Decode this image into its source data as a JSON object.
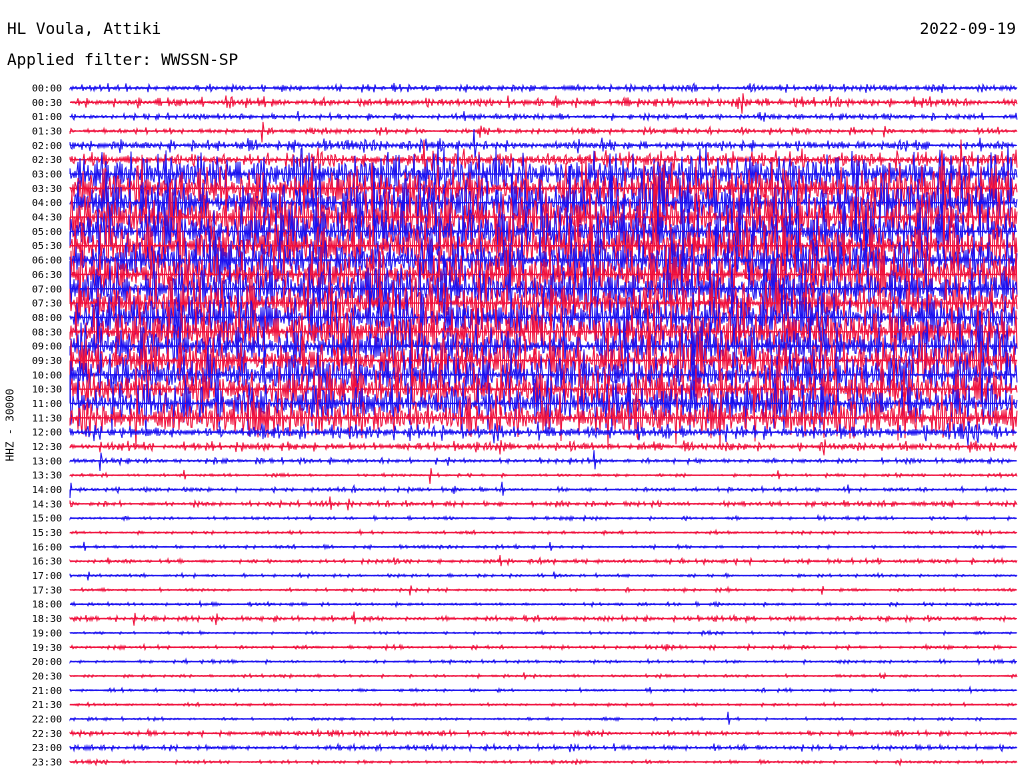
{
  "header": {
    "station": "HL Voula, Attiki",
    "filter_label": "Applied filter: WWSSN-SP",
    "date": "2022-09-19"
  },
  "axis": {
    "ylabel": "HHZ - 30000"
  },
  "colors": {
    "blue": "#1a10f0",
    "red": "#f0103c"
  },
  "chart_data": {
    "type": "helicorder",
    "title": "HL Voula, Attiki",
    "subtitle": "Applied filter: WWSSN-SP",
    "ylabel": "HHZ - 30000",
    "rows": [
      "00:00",
      "00:30",
      "01:00",
      "01:30",
      "02:00",
      "02:30",
      "03:00",
      "03:30",
      "04:00",
      "04:30",
      "05:00",
      "05:30",
      "06:00",
      "06:30",
      "07:00",
      "07:30",
      "08:00",
      "08:30",
      "09:00",
      "09:30",
      "10:00",
      "10:30",
      "11:00",
      "11:30",
      "12:00",
      "12:30",
      "13:00",
      "13:30",
      "14:00",
      "14:30",
      "15:00",
      "15:30",
      "16:00",
      "16:30",
      "17:00",
      "17:30",
      "18:00",
      "18:30",
      "19:00",
      "19:30",
      "20:00",
      "20:30",
      "21:00",
      "21:30",
      "22:00",
      "22:30",
      "23:00",
      "23:30"
    ],
    "trace_colors": [
      "blue",
      "red"
    ],
    "relative_activity": [
      0.15,
      0.2,
      0.12,
      0.12,
      0.25,
      0.4,
      0.6,
      0.85,
      0.95,
      0.95,
      0.95,
      0.9,
      0.9,
      0.85,
      0.85,
      0.8,
      0.85,
      0.8,
      0.75,
      0.7,
      0.6,
      0.55,
      0.6,
      0.55,
      0.35,
      0.2,
      0.1,
      0.05,
      0.08,
      0.1,
      0.05,
      0.05,
      0.05,
      0.1,
      0.05,
      0.05,
      0.05,
      0.1,
      0.04,
      0.06,
      0.05,
      0.04,
      0.05,
      0.04,
      0.04,
      0.1,
      0.12,
      0.05
    ]
  }
}
